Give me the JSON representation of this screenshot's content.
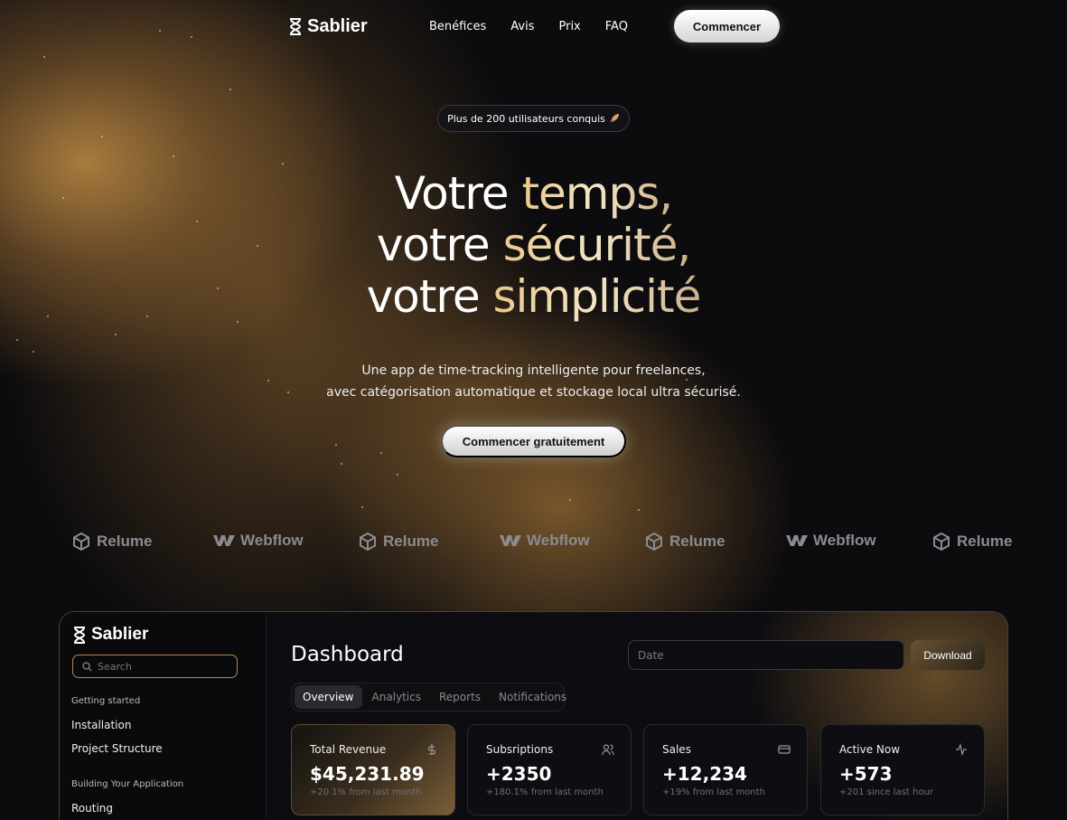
{
  "nav": {
    "brand": "Sablier",
    "links": [
      "Benéfices",
      "Avis",
      "Prix",
      "FAQ"
    ],
    "cta": "Commencer"
  },
  "hero": {
    "badge": "Plus de 200 utilisateurs conquis",
    "badge_icon": "rocket-icon",
    "headline": [
      {
        "plain": "Votre ",
        "accent": "temps,"
      },
      {
        "plain": "votre ",
        "accent": "sécurité,"
      },
      {
        "plain": "votre ",
        "accent": "simplicité"
      }
    ],
    "subtitle_line1": "Une app de time-tracking intelligente pour freelances,",
    "subtitle_line2": "avec catégorisation automatique et stockage local ultra sécurisé.",
    "cta": "Commencer gratuitement"
  },
  "logos": [
    "Relume",
    "Webflow",
    "Relume",
    "Webflow",
    "Relume",
    "Webflow",
    "Relume"
  ],
  "dashboard": {
    "brand": "Sablier",
    "search_placeholder": "Search",
    "sidebar": {
      "section1": "Getting started",
      "items1": [
        "Installation",
        "Project Structure"
      ],
      "section2": "Building Your Application",
      "items2": [
        "Routing"
      ]
    },
    "title": "Dashboard",
    "date_placeholder": "Date",
    "download": "Download",
    "tabs": [
      "Overview",
      "Analytics",
      "Reports",
      "Notifications"
    ],
    "active_tab": "Overview",
    "cards": [
      {
        "title": "Total Revenue",
        "value": "$45,231.89",
        "note": "+20.1% from last month",
        "icon": "dollar-icon"
      },
      {
        "title": "Subsriptions",
        "value": "+2350",
        "note": "+180.1% from last month",
        "icon": "users-icon"
      },
      {
        "title": "Sales",
        "value": "+12,234",
        "note": "+19% from last month",
        "icon": "credit-card-icon"
      },
      {
        "title": "Active Now",
        "value": "+573",
        "note": "+201 since last hour",
        "icon": "activity-icon"
      }
    ]
  },
  "colors": {
    "accent": "#e9c88c",
    "background": "#0c0b0e",
    "glow": "#b08040"
  }
}
